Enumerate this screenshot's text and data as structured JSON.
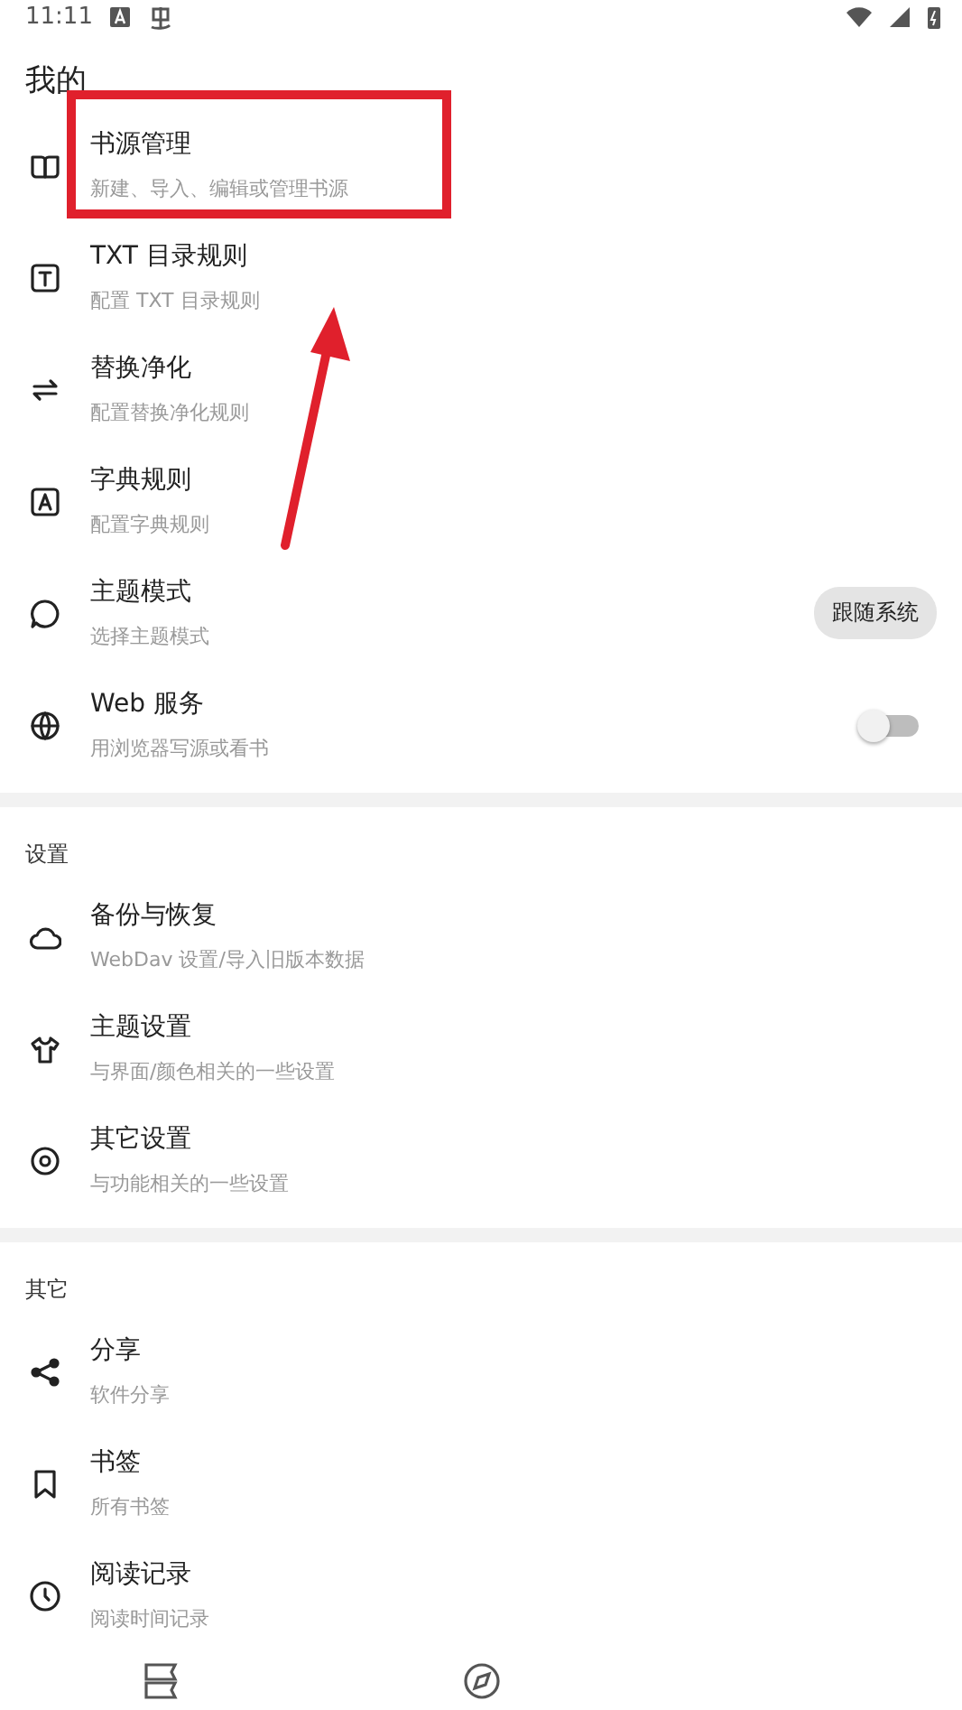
{
  "status_bar": {
    "time": "11:11"
  },
  "title": "我的",
  "sections": [
    {
      "items": [
        {
          "kind": "plain",
          "title": "书源管理",
          "subtitle": "新建、导入、编辑或管理书源",
          "highlighted": true
        },
        {
          "kind": "plain",
          "title": "TXT 目录规则",
          "subtitle": "配置 TXT 目录规则",
          "highlighted": false
        },
        {
          "kind": "plain",
          "title": "替换净化",
          "subtitle": "配置替换净化规则",
          "highlighted": false
        },
        {
          "kind": "plain",
          "title": "字典规则",
          "subtitle": "配置字典规则",
          "highlighted": false
        },
        {
          "kind": "choice",
          "title": "主题模式",
          "subtitle": "选择主题模式",
          "value": "跟随系统",
          "highlighted": false
        },
        {
          "kind": "switch",
          "title": "Web 服务",
          "subtitle": "用浏览器写源或看书",
          "on": false,
          "highlighted": false
        }
      ]
    },
    {
      "header": "设置",
      "items": [
        {
          "kind": "plain",
          "title": "备份与恢复",
          "subtitle": "WebDav 设置/导入旧版本数据",
          "highlighted": false
        },
        {
          "kind": "plain",
          "title": "主题设置",
          "subtitle": "与界面/颜色相关的一些设置",
          "highlighted": false
        },
        {
          "kind": "plain",
          "title": "其它设置",
          "subtitle": "与功能相关的一些设置",
          "highlighted": false
        }
      ]
    },
    {
      "header": "其它",
      "items": [
        {
          "kind": "plain",
          "title": "分享",
          "subtitle": "软件分享",
          "highlighted": false
        },
        {
          "kind": "plain",
          "title": "书签",
          "subtitle": "所有书签",
          "highlighted": false
        },
        {
          "kind": "plain",
          "title": "阅读记录",
          "subtitle": "阅读时间记录",
          "highlighted": false
        }
      ]
    }
  ]
}
